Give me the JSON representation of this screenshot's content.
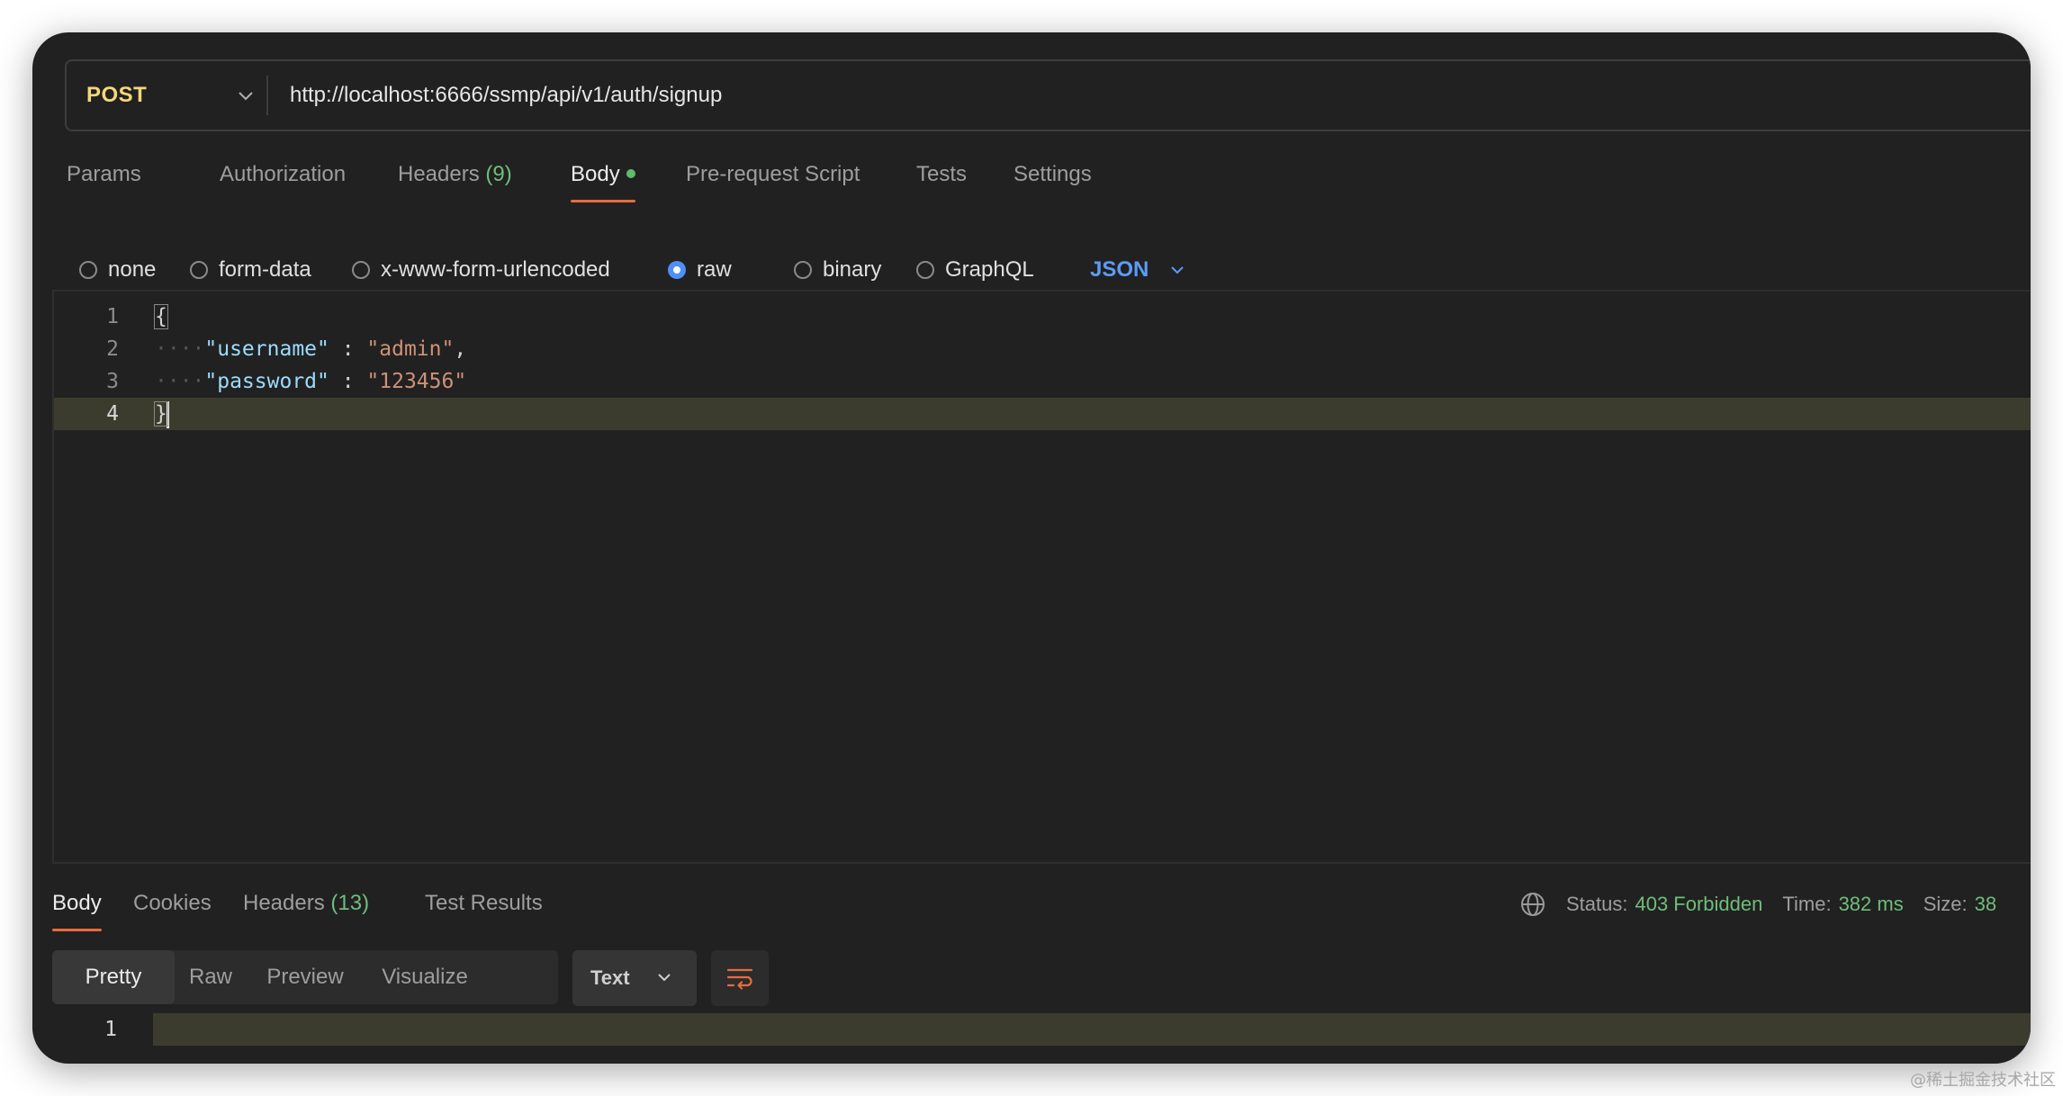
{
  "request": {
    "method": "POST",
    "url": "http://localhost:6666/ssmp/api/v1/auth/signup"
  },
  "request_tabs": [
    {
      "label": "Params"
    },
    {
      "label": "Authorization"
    },
    {
      "label": "Headers",
      "count": "(9)"
    },
    {
      "label": "Body",
      "active": true,
      "has_dot": true
    },
    {
      "label": "Pre-request Script"
    },
    {
      "label": "Tests"
    },
    {
      "label": "Settings"
    }
  ],
  "body_types": [
    {
      "label": "none",
      "checked": false
    },
    {
      "label": "form-data",
      "checked": false
    },
    {
      "label": "x-www-form-urlencoded",
      "checked": false
    },
    {
      "label": "raw",
      "checked": true
    },
    {
      "label": "binary",
      "checked": false
    },
    {
      "label": "GraphQL",
      "checked": false
    }
  ],
  "body_language": "JSON",
  "editor": {
    "lines": [
      {
        "no": "1",
        "text": "{"
      },
      {
        "no": "2",
        "indent": "····",
        "key": "\"username\"",
        "sep": " : ",
        "value": "\"admin\"",
        "trail": ","
      },
      {
        "no": "3",
        "indent": "····",
        "key": "\"password\"",
        "sep": " : ",
        "value": "\"123456\"",
        "trail": ""
      },
      {
        "no": "4",
        "text": "}"
      }
    ],
    "current_line": 4
  },
  "response": {
    "tabs": [
      {
        "label": "Body",
        "active": true
      },
      {
        "label": "Cookies"
      },
      {
        "label": "Headers",
        "count": "(13)"
      },
      {
        "label": "Test Results"
      }
    ],
    "status_label": "Status:",
    "status_value": "403 Forbidden",
    "time_label": "Time:",
    "time_value": "382 ms",
    "size_label": "Size:",
    "size_value": "38",
    "view_modes": [
      "Pretty",
      "Raw",
      "Preview",
      "Visualize"
    ],
    "active_view": "Pretty",
    "format": "Text",
    "lines": [
      {
        "no": "1"
      }
    ]
  },
  "watermark": "@稀土掘金技术社区",
  "colors": {
    "method": "#f5d77a",
    "accent_underline": "#e96b3c",
    "success_green": "#6fbd7a",
    "link_blue": "#5b9cf6",
    "radio_checked": "#4f8ff7",
    "window_bg": "#212121"
  }
}
